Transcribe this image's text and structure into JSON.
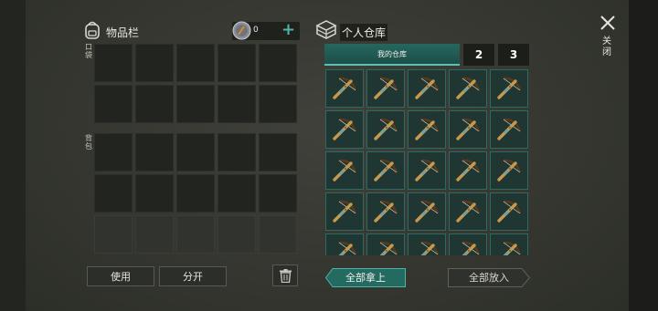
{
  "inventory": {
    "title": "物品栏",
    "coin_count": "0",
    "coin_add": "+",
    "backpack_label": "口袋",
    "equip_label": "背包",
    "buttons": {
      "use": "使用",
      "split": "分开"
    }
  },
  "storage": {
    "title": "个人仓库",
    "tabs": [
      {
        "label": "我的仓库",
        "active": true
      },
      {
        "label": "2",
        "active": false
      },
      {
        "label": "3",
        "active": false
      }
    ],
    "item_icon": "crossbow-icon",
    "visible_item_count": 25,
    "take_all_label": "全部拿上",
    "put_all_label": "全部放入"
  },
  "close": {
    "label": "关闭"
  },
  "colors": {
    "accent": "#4fb3a9",
    "tab_active": "#26675f",
    "slot_border": "#2f6a62",
    "wood": "#c69a4e"
  }
}
